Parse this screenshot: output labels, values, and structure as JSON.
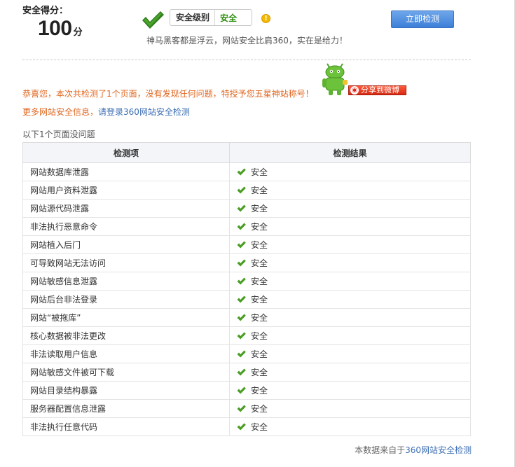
{
  "score": {
    "label": "安全得分：",
    "value": "100",
    "unit": "分"
  },
  "level": {
    "label": "安全级别",
    "value": "安全"
  },
  "slogan": "神马黑客都是浮云，网站安全比肩360，实在是给力！",
  "detect_button": "立即检测",
  "congrats_message": "恭喜您，本次共检测了1个页面，没有发现任何问题，特授予您五星神站称号！",
  "share_button": "分享到微博",
  "more_info": {
    "prefix": "更多网站安全信息，",
    "link": "请登录360网站安全检测"
  },
  "section_title": "以下1个页面没问题",
  "table": {
    "headers": [
      "检测项",
      "检测结果"
    ],
    "rows": [
      {
        "item": "网站数据库泄露",
        "result": "安全"
      },
      {
        "item": "网站用户资料泄露",
        "result": "安全"
      },
      {
        "item": "网站源代码泄露",
        "result": "安全"
      },
      {
        "item": "非法执行恶意命令",
        "result": "安全"
      },
      {
        "item": "网站植入后门",
        "result": "安全"
      },
      {
        "item": "可导致网站无法访问",
        "result": "安全"
      },
      {
        "item": "网站敏感信息泄露",
        "result": "安全"
      },
      {
        "item": "网站后台非法登录",
        "result": "安全"
      },
      {
        "item": "网站“被拖库”",
        "result": "安全"
      },
      {
        "item": "核心数据被非法更改",
        "result": "安全"
      },
      {
        "item": "非法读取用户信息",
        "result": "安全"
      },
      {
        "item": "网站敏感文件被可下载",
        "result": "安全"
      },
      {
        "item": "网站目录结构暴露",
        "result": "安全"
      },
      {
        "item": "服务器配置信息泄露",
        "result": "安全"
      },
      {
        "item": "非法执行任意代码",
        "result": "安全"
      }
    ]
  },
  "footer": {
    "prefix": "本数据来自于",
    "link": "360网站安全检测"
  },
  "colors": {
    "accent_blue": "#3d7fd8",
    "safe_green": "#2d8c0e",
    "highlight_orange": "#e0661f",
    "link_blue": "#3b6eb4"
  },
  "icons": {
    "big_check": "check-icon",
    "warn": "warning-icon",
    "ok": "ok-check-icon",
    "mascot": "mascot-icon",
    "weibo": "weibo-icon"
  }
}
